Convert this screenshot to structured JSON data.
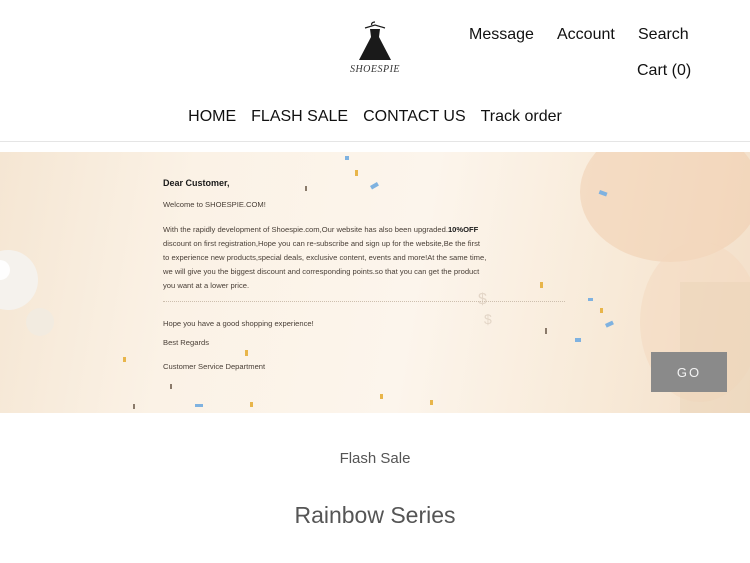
{
  "brand": {
    "name": "SHOESPIE"
  },
  "header": {
    "message_label": "Message",
    "account_label": "Account",
    "search_label": "Search",
    "cart_label": "Cart (0)"
  },
  "nav": {
    "items": [
      "HOME",
      "FLASH SALE",
      "CONTACT US",
      "Track order"
    ]
  },
  "banner": {
    "greeting": "Dear Customer,",
    "welcome": "Welcome to SHOESPIE.COM!",
    "body_line1_prefix": "With the rapidly development of Shoespie.com,Our website has also been upgraded.",
    "body_line1_highlight": "10%OFF",
    "body_line2": "discount on first registration,Hope you can re-subscribe and sign up for the website,Be the first",
    "body_line3": "to experience new products,special deals, exclusive content, events and more!At the same time,",
    "body_line4": "we will give you the biggest discount and corresponding points.so that you can get the product",
    "body_line5": "you want at a lower price.",
    "closing": "Hope you have a good shopping experience!",
    "regards": "Best Regards",
    "department": "Customer Service Department",
    "go_label": "GO",
    "colors": {
      "background": "#f8ecdd",
      "confetti_blue": "#7fb2e0",
      "confetti_gold": "#e8b54a",
      "button": "#8a8a8a"
    }
  },
  "sections": {
    "flash_sale": "Flash Sale",
    "rainbow": "Rainbow Series"
  }
}
